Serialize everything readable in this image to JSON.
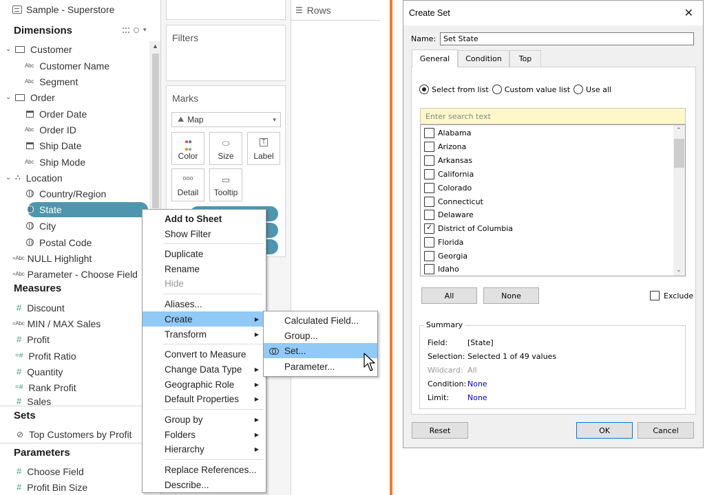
{
  "data_pane": {
    "datasource": "Sample - Superstore",
    "dimensions_title": "Dimensions",
    "measures_title": "Measures",
    "sets_title": "Sets",
    "parameters_title": "Parameters",
    "fields": {
      "customer_folder": "Customer",
      "customer_name": "Customer Name",
      "segment": "Segment",
      "order_folder": "Order",
      "order_date": "Order Date",
      "order_id": "Order ID",
      "ship_date": "Ship Date",
      "ship_mode": "Ship Mode",
      "location_folder": "Location",
      "country_region": "Country/Region",
      "state": "State",
      "city": "City",
      "postal_code": "Postal Code",
      "null_highlight": "NULL Highlight",
      "parameter_choose_field": "Parameter - Choose Field"
    },
    "measures": [
      "Discount",
      "MIN / MAX Sales",
      "Profit",
      "Profit Ratio",
      "Quantity",
      "Rank Profit",
      "Sales"
    ],
    "sets": [
      "Top Customers by Profit"
    ],
    "parameters": [
      "Choose Field",
      "Profit Bin Size"
    ],
    "type_badge": "Abc",
    "type_badge_calc": "=Abc"
  },
  "shelves": {
    "filters_title": "Filters",
    "marks_title": "Marks",
    "mark_type": "Map",
    "buttons": {
      "color": "Color",
      "size": "Size",
      "label": "Label",
      "detail": "Detail",
      "tooltip": "Tooltip"
    },
    "rows_label": "Rows"
  },
  "context_menu": {
    "items": {
      "add_to_sheet": "Add to Sheet",
      "show_filter": "Show Filter",
      "duplicate": "Duplicate",
      "rename": "Rename",
      "hide": "Hide",
      "aliases": "Aliases...",
      "create": "Create",
      "transform": "Transform",
      "convert_to_measure": "Convert to Measure",
      "change_data_type": "Change Data Type",
      "geographic_role": "Geographic Role",
      "default_properties": "Default Properties",
      "group_by": "Group by",
      "folders": "Folders",
      "hierarchy": "Hierarchy",
      "replace_references": "Replace References...",
      "describe": "Describe..."
    },
    "submenu": {
      "calculated_field": "Calculated Field...",
      "group": "Group...",
      "set": "Set...",
      "parameter": "Parameter..."
    }
  },
  "dialog": {
    "title": "Create Set",
    "name_label": "Name:",
    "name_value": "Set State",
    "tabs": [
      "General",
      "Condition",
      "Top"
    ],
    "radios": [
      "Select from list",
      "Custom value list",
      "Use all"
    ],
    "search_placeholder": "Enter search text",
    "states": [
      {
        "name": "Alabama",
        "checked": false
      },
      {
        "name": "Arizona",
        "checked": false
      },
      {
        "name": "Arkansas",
        "checked": false
      },
      {
        "name": "California",
        "checked": false
      },
      {
        "name": "Colorado",
        "checked": false
      },
      {
        "name": "Connecticut",
        "checked": false
      },
      {
        "name": "Delaware",
        "checked": false
      },
      {
        "name": "District of Columbia",
        "checked": true
      },
      {
        "name": "Florida",
        "checked": false
      },
      {
        "name": "Georgia",
        "checked": false
      },
      {
        "name": "Idaho",
        "checked": false
      }
    ],
    "all_btn": "All",
    "none_btn": "None",
    "exclude_label": "Exclude",
    "summary": {
      "legend": "Summary",
      "field_k": "Field:",
      "field_v": "[State]",
      "selection_k": "Selection:",
      "selection_v": "Selected 1 of 49 values",
      "wildcard_k": "Wildcard:",
      "wildcard_v": "All",
      "condition_k": "Condition:",
      "condition_v": "None",
      "limit_k": "Limit:",
      "limit_v": "None"
    },
    "reset_btn": "Reset",
    "ok_btn": "OK",
    "cancel_btn": "Cancel"
  },
  "colors": {
    "accent": "#4f95ad",
    "highlight": "#91c9f7",
    "divider": "#f37b21"
  }
}
